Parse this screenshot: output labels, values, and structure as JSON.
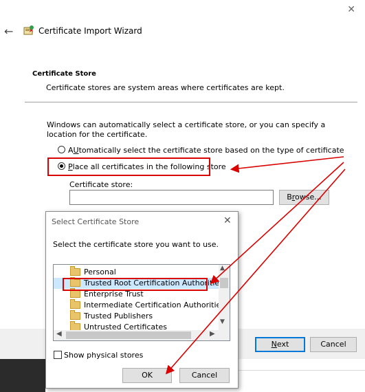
{
  "window": {
    "title": "Certificate Import Wizard",
    "close_glyph": "✕",
    "back_glyph": "←"
  },
  "section": {
    "title": "Certificate Store",
    "description": "Certificate stores are system areas where certificates are kept."
  },
  "intro": "Windows can automatically select a certificate store, or you can specify a location for the certificate.",
  "options": {
    "auto": {
      "hotkey": "U",
      "rest": "tomatically select the certificate store based on the type of certificate",
      "prefix": "A",
      "selected": false
    },
    "place": {
      "hotkey": "P",
      "rest": "lace all certificates in the following store",
      "selected": true
    }
  },
  "store": {
    "label": "Certificate store:",
    "value": "",
    "browse_hotkey": "r",
    "browse_prefix": "B",
    "browse_rest": "owse..."
  },
  "footer": {
    "next_hotkey": "N",
    "next_rest": "ext",
    "cancel": "Cancel"
  },
  "dialog": {
    "title": "Select Certificate Store",
    "close_glyph": "✕",
    "prompt": "Select the certificate store you want to use.",
    "stores": [
      {
        "label": "Personal",
        "selected": false
      },
      {
        "label": "Trusted Root Certification Authorities",
        "selected": true
      },
      {
        "label": "Enterprise Trust",
        "selected": false
      },
      {
        "label": "Intermediate Certification Authorities",
        "selected": false
      },
      {
        "label": "Trusted Publishers",
        "selected": false
      },
      {
        "label": "Untrusted Certificates",
        "selected": false
      }
    ],
    "show_physical": {
      "label": "Show physical stores",
      "checked": false
    },
    "ok": "OK",
    "cancel": "Cancel"
  },
  "colors": {
    "highlight": "#d90000",
    "accent": "#0078d7",
    "selection": "#cce8ff"
  },
  "icons": {
    "wizard": "certificate-wizard-icon",
    "folder": "folder-icon"
  }
}
